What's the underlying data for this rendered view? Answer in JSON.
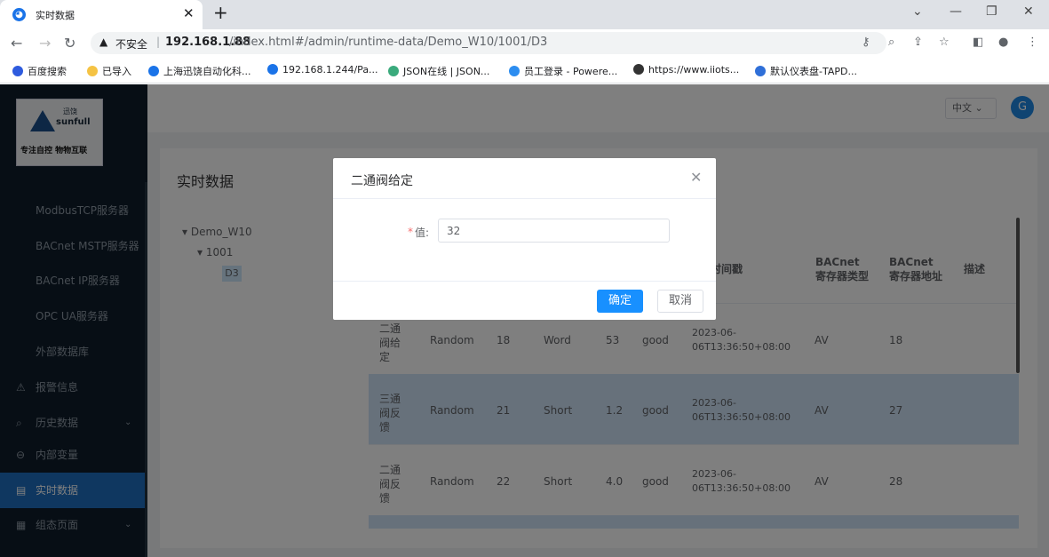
{
  "browser": {
    "tab_title": "实时数据",
    "favicon": "◕",
    "insecure_label": "不安全",
    "url_host": "192.168.1.88",
    "url_path": "/index.html#/admin/runtime-data/Demo_W10/1001/D3",
    "bookmarks": [
      {
        "label": "百度搜索",
        "color": "#2e5bde"
      },
      {
        "label": "已导入",
        "color": "#f5c344"
      },
      {
        "label": "上海迅饶自动化科...",
        "color": "#1a73e8"
      },
      {
        "label": "192.168.1.244/Pa...",
        "color": "#1a73e8"
      },
      {
        "label": "JSON在线 | JSON...",
        "color": "#3aaa7c"
      },
      {
        "label": "员工登录 - Powere...",
        "color": "#2c8df0"
      },
      {
        "label": "https://www.iiots...",
        "color": "#333333"
      },
      {
        "label": "默认仪表盘-TAPD...",
        "color": "#2f6fd8"
      }
    ]
  },
  "logo": {
    "cn": "迅饶",
    "en": "sunfull",
    "slogan": "专注自控 物物互联"
  },
  "sidebar": {
    "items": [
      {
        "label": "ModbusTCP服务器"
      },
      {
        "label": "BACnet MSTP服务器"
      },
      {
        "label": "BACnet IP服务器"
      },
      {
        "label": "OPC UA服务器"
      },
      {
        "label": "外部数据库"
      },
      {
        "label": "报警信息",
        "icon": "⚠"
      },
      {
        "label": "历史数据",
        "icon": "⌕",
        "arrow": "⌄"
      },
      {
        "label": "内部变量",
        "icon": "⊖"
      },
      {
        "label": "实时数据",
        "icon": "▤"
      },
      {
        "label": "组态页面",
        "icon": "▦",
        "arrow": "⌄"
      }
    ]
  },
  "header": {
    "lang": "中文 ⌄",
    "avatar": "G"
  },
  "page": {
    "title": "实时数据"
  },
  "tree": {
    "root": "▾  Demo_W10",
    "child": "▾  1001",
    "leaf": "D3"
  },
  "table": {
    "headers": {
      "time": "时间戳",
      "bac_type": "BACnet寄存器类型",
      "bac_addr": "BACnet寄存器地址",
      "desc": "描述"
    },
    "rows": [
      {
        "name": "二通阀给定",
        "mode": "Random",
        "addr": "18",
        "type": "Word",
        "value": "53",
        "quality": "good",
        "time": "2023-06-06T13:36:50+08:00",
        "bac_type": "AV",
        "bac_addr": "18"
      },
      {
        "name": "三通阀反馈",
        "mode": "Random",
        "addr": "21",
        "type": "Short",
        "value": "1.2",
        "quality": "good",
        "time": "2023-06-06T13:36:50+08:00",
        "bac_type": "AV",
        "bac_addr": "27"
      },
      {
        "name": "二通阀反馈",
        "mode": "Random",
        "addr": "22",
        "type": "Short",
        "value": "4.0",
        "quality": "good",
        "time": "2023-06-06T13:36:50+08:00",
        "bac_type": "AV",
        "bac_addr": "28"
      }
    ]
  },
  "modal": {
    "title": "二通阀给定",
    "required_mark": "*",
    "value_label": "值:",
    "value": "32",
    "ok_label": "确定",
    "cancel_label": "取消"
  },
  "colors": {
    "primary": "#1890ff",
    "sidebar_bg": "#0e1c2a",
    "menu_active": "#1f6fc1",
    "row_highlight": "#cfe3f7"
  }
}
